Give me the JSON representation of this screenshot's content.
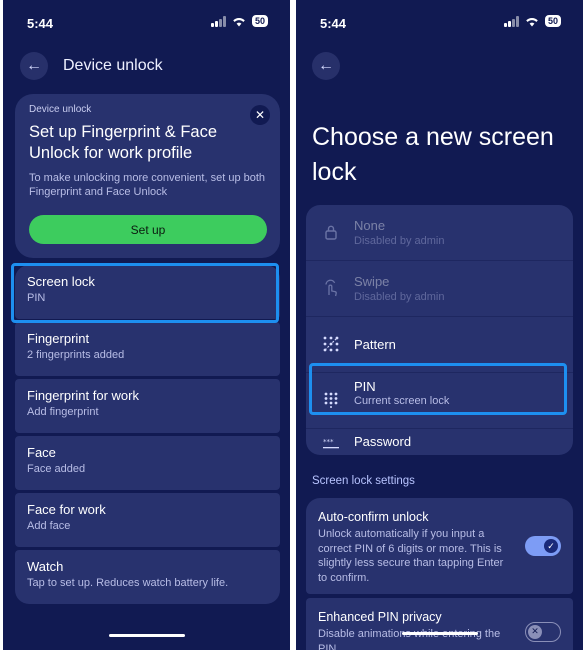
{
  "left": {
    "status": {
      "time": "5:44",
      "battery": "50"
    },
    "title": "Device unlock",
    "promo": {
      "small": "Device unlock",
      "heading": "Set up Fingerprint & Face Unlock for work profile",
      "description": "To make unlocking more convenient, set up both Fingerprint and Face Unlock",
      "button": "Set up"
    },
    "items": [
      {
        "title": "Screen lock",
        "subtitle": "PIN"
      },
      {
        "title": "Fingerprint",
        "subtitle": "2 fingerprints added"
      },
      {
        "title": "Fingerprint for work",
        "subtitle": "Add fingerprint"
      },
      {
        "title": "Face",
        "subtitle": "Face added"
      },
      {
        "title": "Face for work",
        "subtitle": "Add face"
      },
      {
        "title": "Watch",
        "subtitle": "Tap to set up. Reduces watch battery life."
      }
    ]
  },
  "right": {
    "status": {
      "time": "5:44",
      "battery": "50"
    },
    "title": "Choose a new screen lock",
    "options": [
      {
        "title": "None",
        "subtitle": "Disabled by admin",
        "icon": "lock-icon"
      },
      {
        "title": "Swipe",
        "subtitle": "Disabled by admin",
        "icon": "swipe-icon"
      },
      {
        "title": "Pattern",
        "subtitle": "",
        "icon": "pattern-icon"
      },
      {
        "title": "PIN",
        "subtitle": "Current screen lock",
        "icon": "pin-keypad-icon"
      },
      {
        "title": "Password",
        "subtitle": "",
        "icon": "password-icon"
      }
    ],
    "section_header": "Screen lock settings",
    "settings": [
      {
        "title": "Auto-confirm unlock",
        "description": "Unlock automatically if you input a correct PIN of 6 digits or more. This is slightly less secure than tapping Enter to confirm.",
        "enabled": true
      },
      {
        "title": "Enhanced PIN privacy",
        "description": "Disable animations while entering the PIN",
        "enabled": false
      }
    ]
  },
  "colors": {
    "background": "#111a52",
    "card": "#28326e",
    "highlight": "#1d8ff0",
    "button": "#3dcc5e",
    "toggle_on": "#7d9cf5"
  }
}
